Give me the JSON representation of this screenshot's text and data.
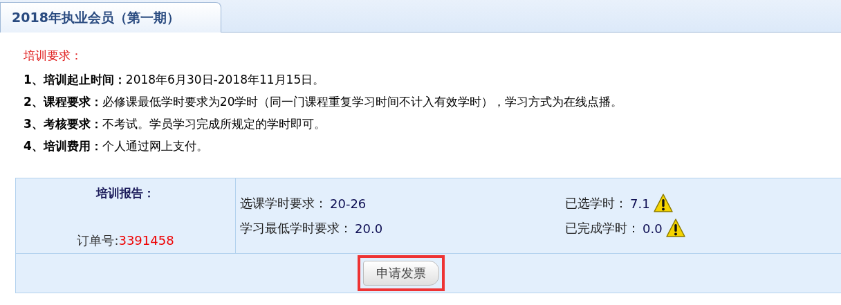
{
  "tabs": [
    {
      "label": "2018年执业会员（第一期）",
      "selected": true
    }
  ],
  "requirements": {
    "heading": "培训要求：",
    "items": [
      {
        "label": "1、培训起止时间：",
        "text": "2018年6月30日-2018年11月15日。"
      },
      {
        "label": "2、课程要求：",
        "text": "必修课最低学时要求为20学时（同一门课程重复学习时间不计入有效学时），学习方式为在线点播。"
      },
      {
        "label": "3、考核要求：",
        "text": "不考试。学员学习完成所规定的学时即可。"
      },
      {
        "label": "4、培训费用：",
        "text": "个人通过网上支付。"
      }
    ]
  },
  "report": {
    "title": "培训报告：",
    "order_label": "订单号:",
    "order_number": "3391458",
    "stats": [
      {
        "label": "选课学时要求：",
        "value": "20-26",
        "warning": false
      },
      {
        "label": "已选学时：",
        "value": "7.1",
        "warning": true
      },
      {
        "label": "学习最低学时要求：",
        "value": "20.0",
        "warning": false
      },
      {
        "label": "已完成学时：",
        "value": "0.0",
        "warning": true
      }
    ],
    "button": {
      "label": "申请发票",
      "highlighted": true
    }
  }
}
